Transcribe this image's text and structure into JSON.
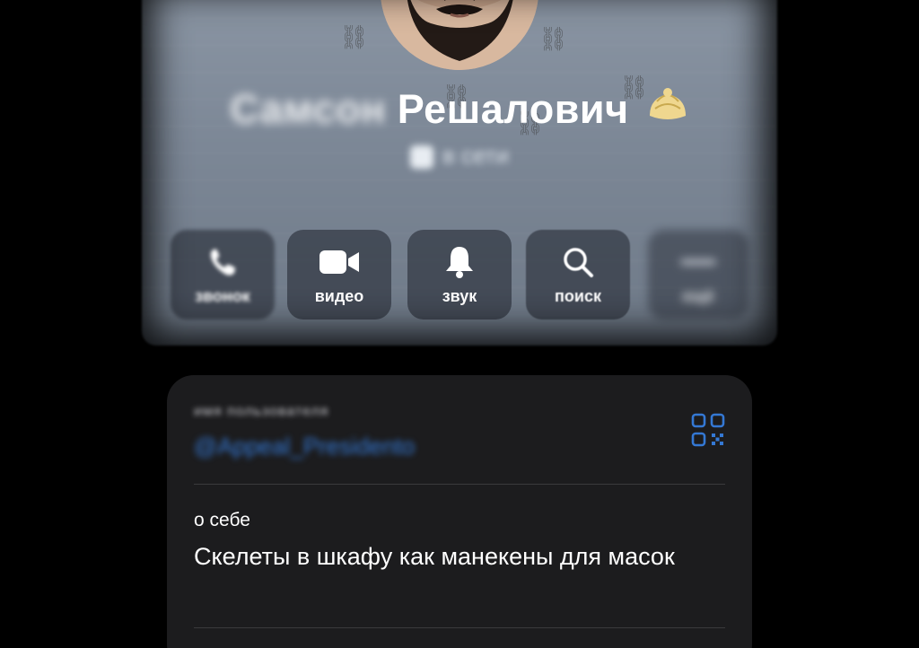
{
  "profile": {
    "first_name": "Самсон",
    "last_name": "Решалович",
    "emoji_icon": "dumpling-icon",
    "status": "в сети"
  },
  "actions": [
    {
      "label": "звонок",
      "icon": "phone-icon"
    },
    {
      "label": "видео",
      "icon": "video-camera-icon"
    },
    {
      "label": "звук",
      "icon": "bell-icon"
    },
    {
      "label": "поиск",
      "icon": "search-icon"
    },
    {
      "label": "ещё",
      "icon": "more-icon"
    }
  ],
  "info": {
    "username_label": "имя пользователя",
    "username_value": "@Appeal_Presidento",
    "qr_icon": "qr-code-icon",
    "about_label": "о себе",
    "about_value": "Скелеты в шкафу как манекены для масок"
  },
  "colors": {
    "header_bg": "#7c8796",
    "card_bg": "#1c1c1e",
    "link_blue": "#3478d4",
    "background": "#000000"
  }
}
